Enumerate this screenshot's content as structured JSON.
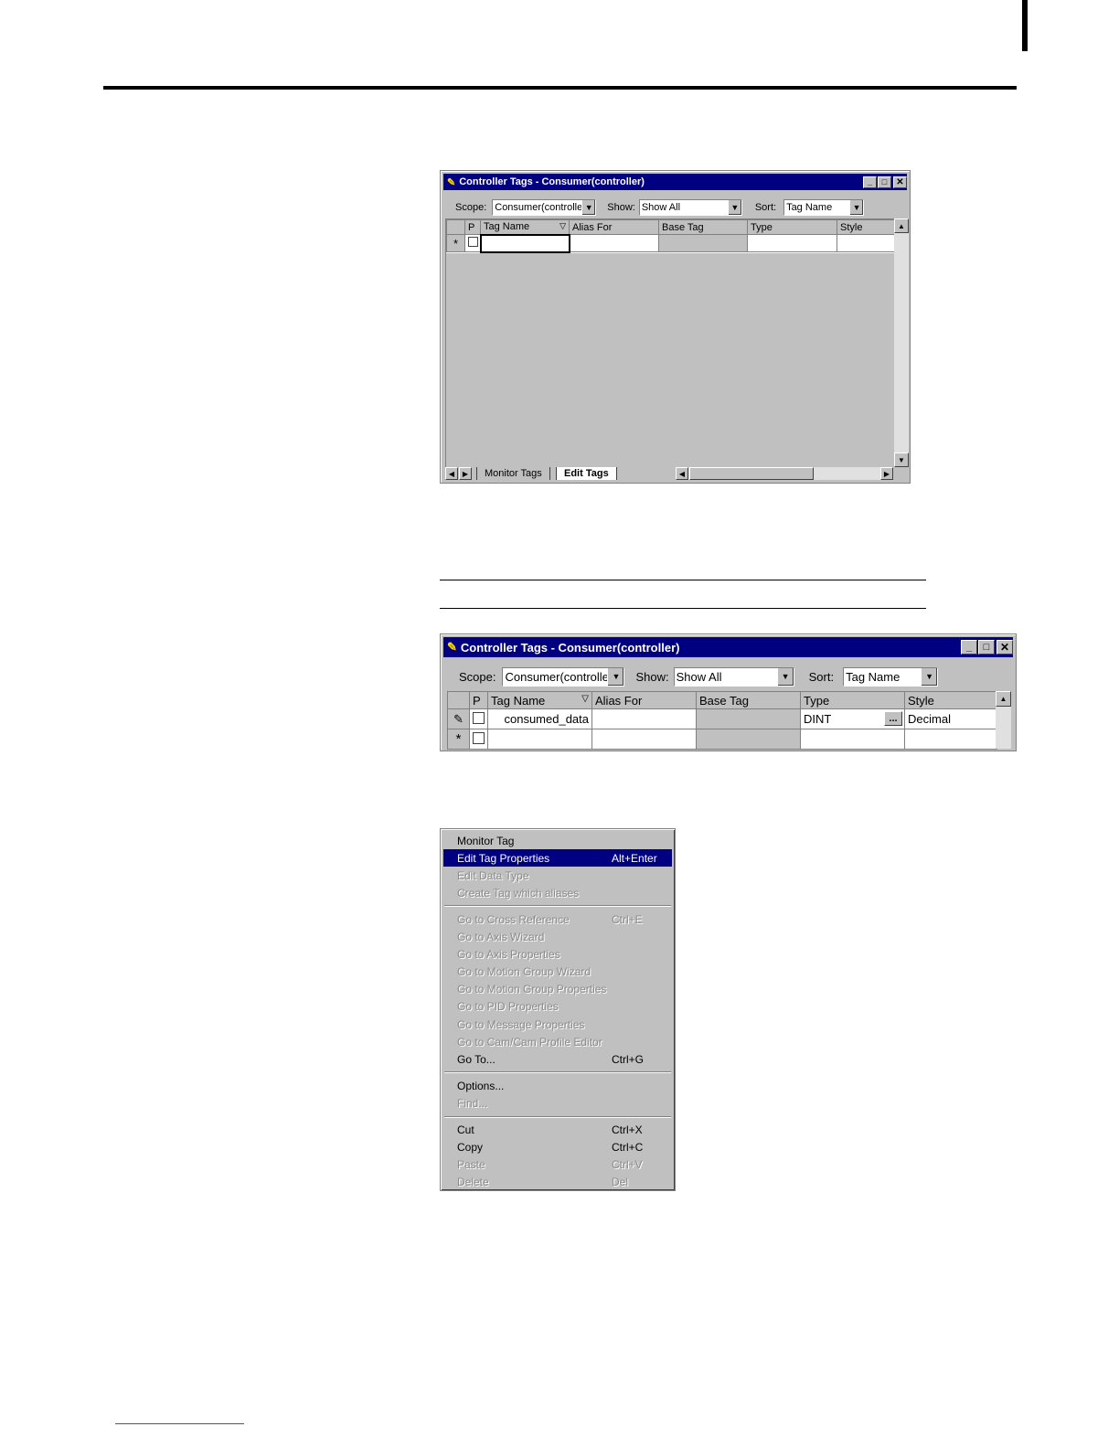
{
  "window1": {
    "title": "Controller Tags - Consumer(controller)",
    "scope_label": "Scope:",
    "scope_value": "Consumer(controller)",
    "show_label": "Show:",
    "show_value": "Show All",
    "sort_label": "Sort:",
    "sort_value": "Tag Name",
    "columns": [
      "P",
      "Tag Name",
      "Alias For",
      "Base Tag",
      "Type",
      "Style"
    ],
    "new_row_marker": "*",
    "tabs": [
      "Monitor Tags",
      "Edit Tags"
    ]
  },
  "window2": {
    "title": "Controller Tags - Consumer(controller)",
    "scope_label": "Scope:",
    "scope_value": "Consumer(controller)",
    "show_label": "Show:",
    "show_value": "Show All",
    "sort_label": "Sort:",
    "sort_value": "Tag Name",
    "columns": [
      "P",
      "Tag Name",
      "Alias For",
      "Base Tag",
      "Type",
      "Style"
    ],
    "row": {
      "tag_name": "consumed_data",
      "type": "DINT",
      "style": "Decimal"
    },
    "browse_button": "...",
    "new_row_marker": "*"
  },
  "context_menu": {
    "items": [
      {
        "label": "Monitor Tag",
        "shortcut": "",
        "disabled": false
      },
      {
        "label": "Edit Tag Properties",
        "shortcut": "Alt+Enter",
        "disabled": false,
        "selected": true
      },
      {
        "label": "Edit Data Type",
        "shortcut": "",
        "disabled": true
      },
      {
        "label": "Create Tag which aliases",
        "shortcut": "",
        "disabled": true
      },
      {
        "label": "Go to Cross Reference",
        "shortcut": "Ctrl+E",
        "disabled": true
      },
      {
        "label": "Go to Axis Wizard",
        "shortcut": "",
        "disabled": true
      },
      {
        "label": "Go to Axis Properties",
        "shortcut": "",
        "disabled": true
      },
      {
        "label": "Go to Motion Group Wizard",
        "shortcut": "",
        "disabled": true
      },
      {
        "label": "Go to Motion Group Properties",
        "shortcut": "",
        "disabled": true
      },
      {
        "label": "Go to PID Properties",
        "shortcut": "",
        "disabled": true
      },
      {
        "label": "Go to Message Properties",
        "shortcut": "",
        "disabled": true
      },
      {
        "label": "Go to Cam/Cam Profile Editor",
        "shortcut": "",
        "disabled": true
      },
      {
        "label": "Go To...",
        "shortcut": "Ctrl+G",
        "disabled": false
      },
      {
        "label": "Options...",
        "shortcut": "",
        "disabled": false
      },
      {
        "label": "Find...",
        "shortcut": "",
        "disabled": true
      },
      {
        "label": "Cut",
        "shortcut": "Ctrl+X",
        "disabled": false
      },
      {
        "label": "Copy",
        "shortcut": "Ctrl+C",
        "disabled": false
      },
      {
        "label": "Paste",
        "shortcut": "Ctrl+V",
        "disabled": true
      },
      {
        "label": "Delete",
        "shortcut": "Del",
        "disabled": true
      }
    ]
  },
  "colors": {
    "titlebar": "#000080",
    "face": "#c0c0c0",
    "highlight": "#000080"
  }
}
